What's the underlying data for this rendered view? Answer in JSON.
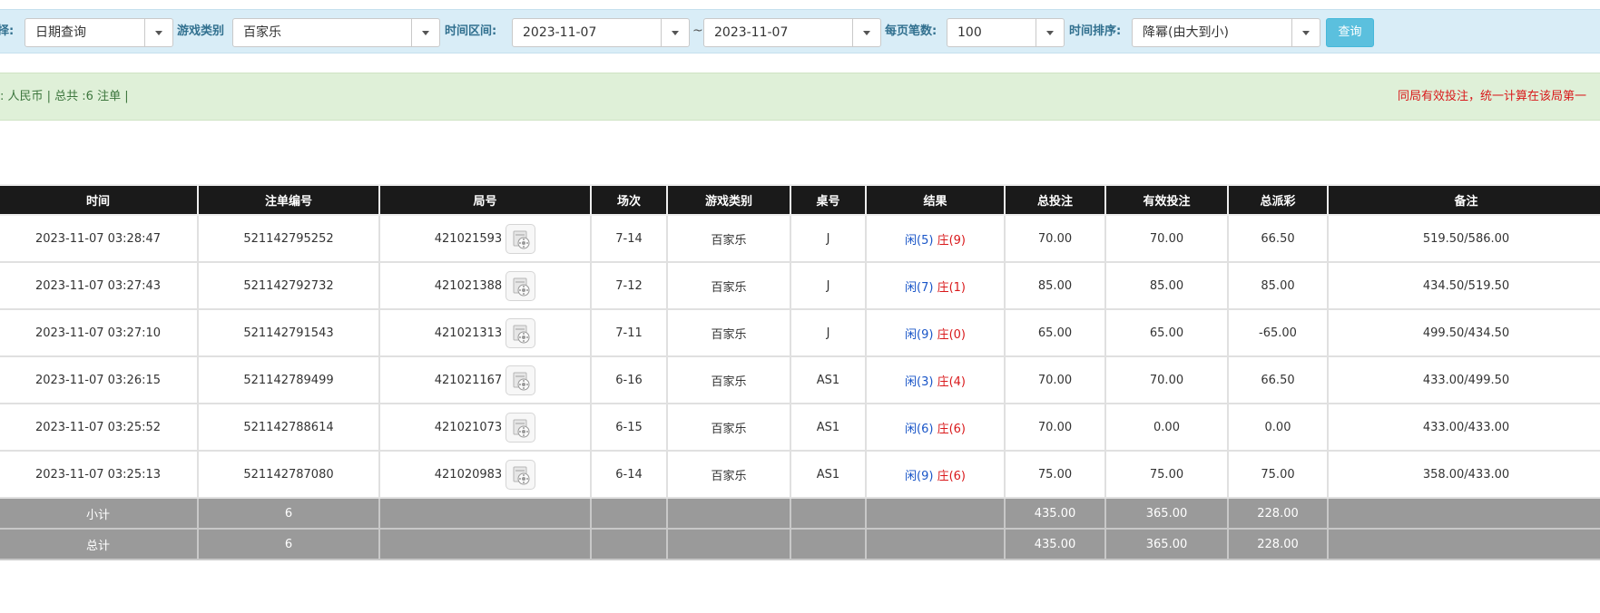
{
  "filter": {
    "mode_label": "择:",
    "mode_value": "日期查询",
    "game_type_label": "游戏类别",
    "game_type_value": "百家乐",
    "date_range_label": "时间区间:",
    "date_from": "2023-11-07",
    "date_sep": "~",
    "date_to": "2023-11-07",
    "per_page_label": "每页笔数:",
    "per_page_value": "100",
    "sort_label": "时间排序:",
    "sort_value": "降幂(由大到小)",
    "query_button": "查询"
  },
  "info": {
    "left_text": ": 人民币 | 总共 :6 注单 |",
    "right_text": "同局有效投注，统一计算在该局第一"
  },
  "colors": {
    "header_bg": "#1a1a1a",
    "summary_bg": "#9a9a9a",
    "player_color": "#1a56c8",
    "banker_color": "#d9191b",
    "negative_color": "#d9191b",
    "total_bet_color": "#1a56c8"
  },
  "table": {
    "columns": [
      "时间",
      "注单编号",
      "局号",
      "场次",
      "游戏类别",
      "桌号",
      "结果",
      "总投注",
      "有效投注",
      "总派彩",
      "备注"
    ],
    "rows": [
      {
        "time": "2023-11-07 03:28:47",
        "order_no": "521142795252",
        "round_no": "421021593",
        "session": "7-14",
        "game": "百家乐",
        "table_no": "J",
        "player": "闲(5)",
        "banker": "庄(9)",
        "total_bet": "70.00",
        "valid_bet": "70.00",
        "payout": "66.50",
        "payout_negative": false,
        "remark": "519.50/586.00"
      },
      {
        "time": "2023-11-07 03:27:43",
        "order_no": "521142792732",
        "round_no": "421021388",
        "session": "7-12",
        "game": "百家乐",
        "table_no": "J",
        "player": "闲(7)",
        "banker": "庄(1)",
        "total_bet": "85.00",
        "valid_bet": "85.00",
        "payout": "85.00",
        "payout_negative": false,
        "remark": "434.50/519.50"
      },
      {
        "time": "2023-11-07 03:27:10",
        "order_no": "521142791543",
        "round_no": "421021313",
        "session": "7-11",
        "game": "百家乐",
        "table_no": "J",
        "player": "闲(9)",
        "banker": "庄(0)",
        "total_bet": "65.00",
        "valid_bet": "65.00",
        "payout": "-65.00",
        "payout_negative": true,
        "remark": "499.50/434.50"
      },
      {
        "time": "2023-11-07 03:26:15",
        "order_no": "521142789499",
        "round_no": "421021167",
        "session": "6-16",
        "game": "百家乐",
        "table_no": "AS1",
        "player": "闲(3)",
        "banker": "庄(4)",
        "total_bet": "70.00",
        "valid_bet": "70.00",
        "payout": "66.50",
        "payout_negative": false,
        "remark": "433.00/499.50"
      },
      {
        "time": "2023-11-07 03:25:52",
        "order_no": "521142788614",
        "round_no": "421021073",
        "session": "6-15",
        "game": "百家乐",
        "table_no": "AS1",
        "player": "闲(6)",
        "banker": "庄(6)",
        "total_bet": "70.00",
        "valid_bet": "0.00",
        "payout": "0.00",
        "payout_negative": false,
        "remark": "433.00/433.00"
      },
      {
        "time": "2023-11-07 03:25:13",
        "order_no": "521142787080",
        "round_no": "421020983",
        "session": "6-14",
        "game": "百家乐",
        "table_no": "AS1",
        "player": "闲(9)",
        "banker": "庄(6)",
        "total_bet": "75.00",
        "valid_bet": "75.00",
        "payout": "75.00",
        "payout_negative": false,
        "remark": "358.00/433.00"
      }
    ],
    "subtotal": {
      "label": "小计",
      "count": "6",
      "total_bet": "435.00",
      "valid_bet": "365.00",
      "payout": "228.00"
    },
    "grandtotal": {
      "label": "总计",
      "count": "6",
      "total_bet": "435.00",
      "valid_bet": "365.00",
      "payout": "228.00"
    }
  }
}
